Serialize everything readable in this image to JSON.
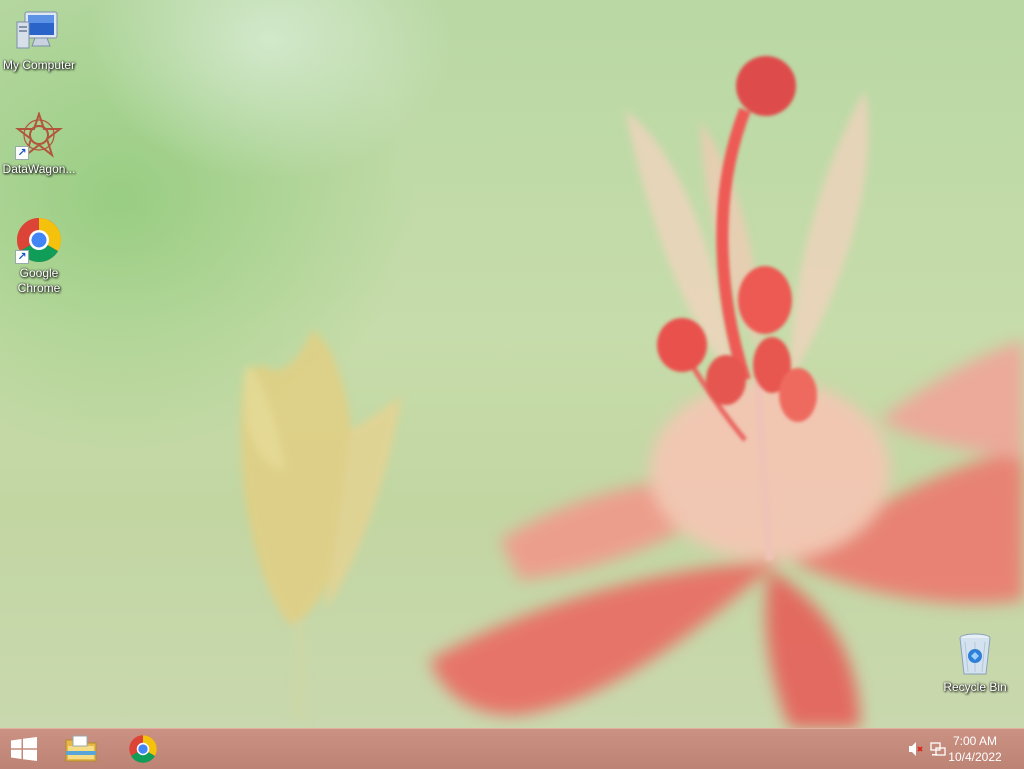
{
  "desktop": {
    "icons": [
      {
        "label": "My Computer",
        "icon": "computer-icon"
      },
      {
        "label": "DataWagon...",
        "icon": "datawagon-icon",
        "shortcut": true
      },
      {
        "label": "Google Chrome",
        "icon": "chrome-icon",
        "shortcut": true
      },
      {
        "label": "Recycle Bin",
        "icon": "recycle-bin-icon"
      }
    ]
  },
  "taskbar": {
    "start_icon": "windows-start-icon",
    "pinned": [
      {
        "name": "File Explorer",
        "icon": "folder-icon"
      },
      {
        "name": "Google Chrome",
        "icon": "chrome-icon"
      }
    ],
    "tray": {
      "volume_icon": "volume-muted-icon",
      "network_icon": "network-icon",
      "time": "7:00 AM",
      "date": "10/4/2022"
    }
  },
  "colors": {
    "taskbar": "#c08a7a",
    "wallpaper_green": "#c2d6a2",
    "flower_red": "#e8645a",
    "chrome_red": "#db4437",
    "chrome_yellow": "#f4c20d",
    "chrome_green": "#0f9d58",
    "chrome_blue": "#4285f4"
  }
}
